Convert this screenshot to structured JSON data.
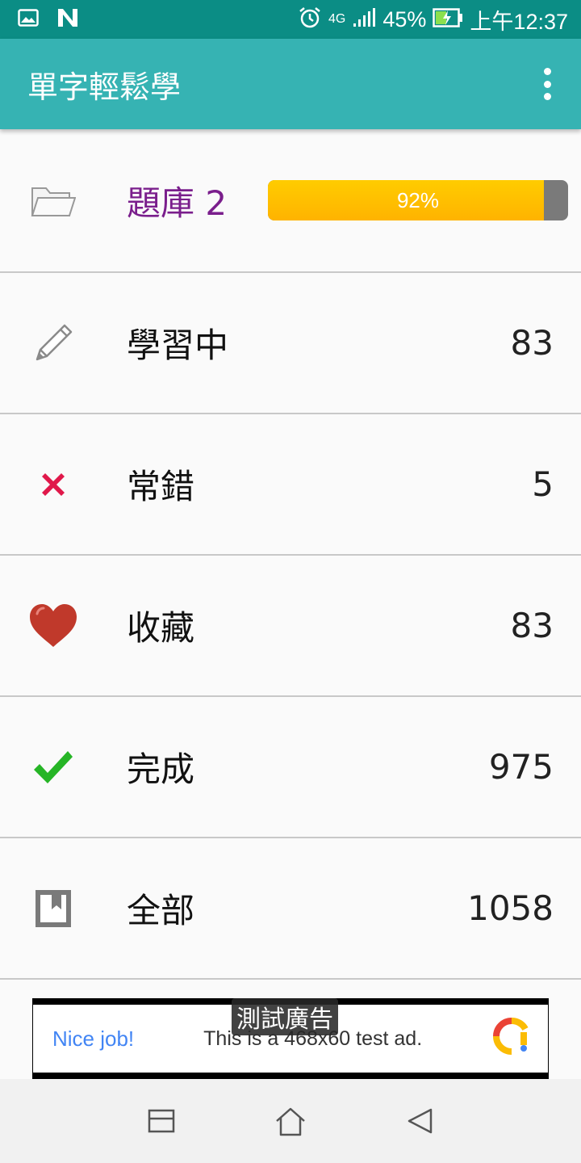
{
  "status_bar": {
    "network_type": "4G",
    "battery_percent": "45%",
    "time": "上午12:37",
    "icons": [
      "image-icon",
      "n-app-icon",
      "alarm-icon",
      "signal-icon",
      "battery-charging-icon"
    ]
  },
  "app_bar": {
    "title": "單字輕鬆學",
    "menu_icon": "more-vert-icon"
  },
  "word_bank": {
    "label": "題庫 2",
    "icon": "folder-icon",
    "progress_percent": 92,
    "progress_text": "92%"
  },
  "rows": [
    {
      "label": "學習中",
      "count": "83",
      "icon": "pencil-icon"
    },
    {
      "label": "常錯",
      "count": "5",
      "icon": "cross-icon"
    },
    {
      "label": "收藏",
      "count": "83",
      "icon": "heart-icon"
    },
    {
      "label": "完成",
      "count": "975",
      "icon": "check-icon"
    },
    {
      "label": "全部",
      "count": "1058",
      "icon": "bookmark-icon"
    }
  ],
  "ad": {
    "badge": "測試廣告",
    "headline": "Nice job!",
    "text": "This is a 468x60 test ad."
  },
  "colors": {
    "status_bar": "#0b8d85",
    "app_bar": "#36b3b3",
    "bank_label": "#7a1e8c",
    "progress_fill": "#ffc107",
    "progress_track": "#7a7a7a"
  }
}
